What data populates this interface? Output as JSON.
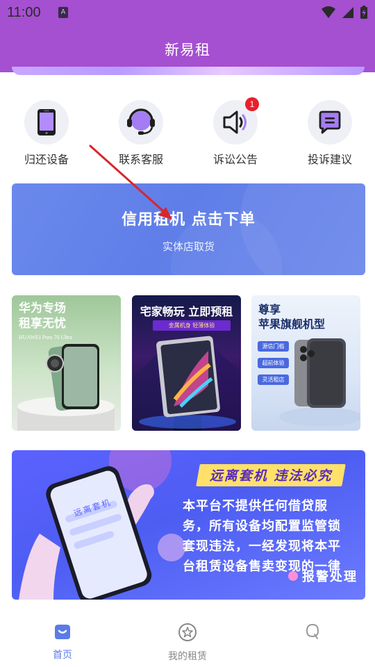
{
  "status_bar": {
    "time": "11:00",
    "app_icon_letter": "A"
  },
  "header": {
    "title": "新易租"
  },
  "quick_actions": [
    {
      "label": "归还设备",
      "icon": "phone-icon"
    },
    {
      "label": "联系客服",
      "icon": "headset-icon"
    },
    {
      "label": "诉讼公告",
      "icon": "speaker-icon",
      "badge": "1"
    },
    {
      "label": "投诉建议",
      "icon": "message-icon"
    }
  ],
  "order_banner": {
    "title": "信用租机 点击下单",
    "subtitle": "实体店取货"
  },
  "promos": [
    {
      "title_line1": "华为专场",
      "title_line2": "租享无忧",
      "model": "HUAWEI Pura 70 Ultra"
    },
    {
      "title": "宅家畅玩 立即预租",
      "tag": "金属机身 轻薄体验"
    },
    {
      "title_line1": "尊享",
      "title_line2": "苹果旗舰机型",
      "chips": [
        "源信门槛",
        "超前体验",
        "灵活租店"
      ]
    }
  ],
  "notice": {
    "phone_text": "远离套机",
    "title": "远离套机 违法必究",
    "lines": [
      "本平台不提供任何借贷服",
      "务，所有设备均配置监管锁",
      "套现违法，一经发现将本平",
      "台租赁设备售卖变现的一律"
    ],
    "last": "报警处理"
  },
  "bottom_nav": [
    {
      "label": "首页",
      "icon": "home-icon",
      "active": true
    },
    {
      "label": "我的租赁",
      "icon": "star-icon",
      "active": false
    },
    {
      "label": "",
      "icon": "profile-icon",
      "active": false
    }
  ],
  "colors": {
    "header": "#a54fd1",
    "accent": "#5b7be8",
    "badge": "#e8202b",
    "annotation": "#d8262c"
  }
}
